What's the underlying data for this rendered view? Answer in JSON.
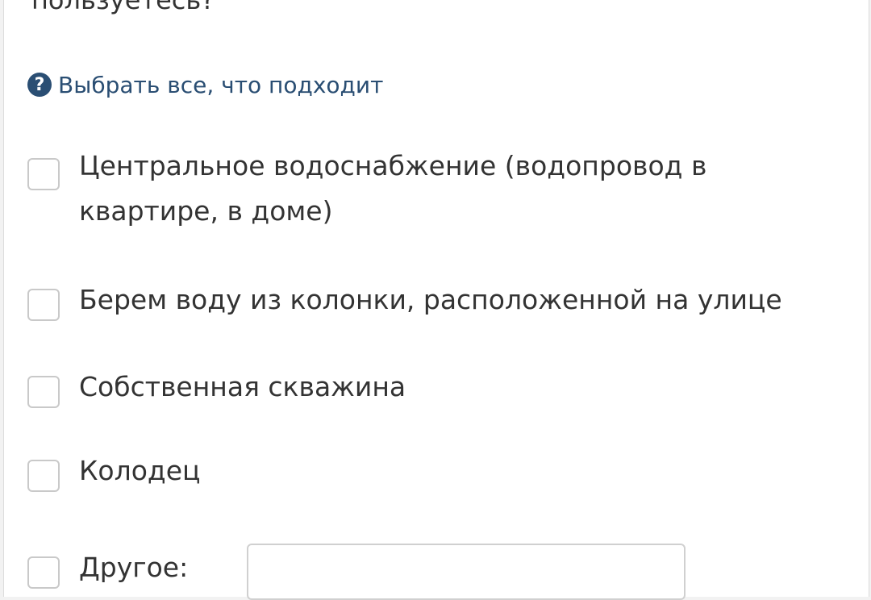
{
  "question": {
    "text": "пользуетесь?"
  },
  "hint": {
    "icon": "question-circle-icon",
    "text": "Выбрать все, что подходит"
  },
  "options": [
    {
      "label": "Центральное водоснабжение (водопровод в квартире, в доме)",
      "checked": false
    },
    {
      "label": "Берем воду из колонки, расположенной на улице",
      "checked": false
    },
    {
      "label": "Собственная скважина",
      "checked": false
    },
    {
      "label": "Колодец",
      "checked": false
    },
    {
      "label": "Другое:",
      "checked": false
    }
  ],
  "other_input": {
    "value": "",
    "placeholder": ""
  },
  "colors": {
    "hint": "#2a4e73",
    "text": "#333333",
    "checkbox_border": "#c9c9c9"
  }
}
